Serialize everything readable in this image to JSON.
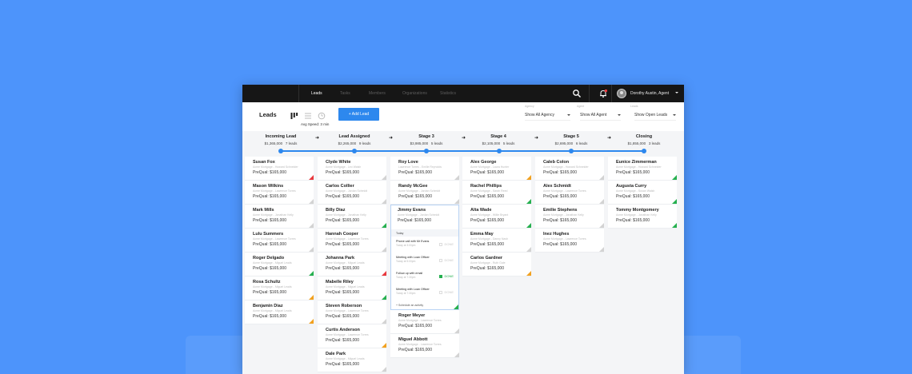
{
  "topbar": {
    "tabs": [
      {
        "label": "Leads",
        "active": true
      },
      {
        "label": "Tasks",
        "active": false
      },
      {
        "label": "Members",
        "active": false
      },
      {
        "label": "Organizations",
        "active": false
      },
      {
        "label": "Statistics",
        "active": false
      }
    ],
    "user_name": "Dorothy Austin, Agent",
    "icons": [
      "search-icon",
      "bell-icon",
      "avatar"
    ]
  },
  "toolbar": {
    "title": "Leads",
    "tooltip": "Avg Speed: 3 min",
    "add_button": "+ Add Lead",
    "filters": [
      {
        "label": "Agency",
        "value": "Show All Agency"
      },
      {
        "label": "Agent",
        "value": "Show All Agent"
      },
      {
        "label": "Leads",
        "value": "Show Open Leads"
      }
    ]
  },
  "colors": {
    "accent": "#2d88ee",
    "background": "#4d94fb",
    "topbar": "#161616",
    "red": "#e9383d",
    "green": "#25b04f",
    "orange": "#f2a11f"
  },
  "stages": [
    {
      "name": "Incoming Lead",
      "amount": "$1,365,000",
      "count": "7 leads"
    },
    {
      "name": "Lead Assigned",
      "amount": "$2,265,000",
      "count": "9 leads"
    },
    {
      "name": "Stage 3",
      "amount": "$3,985,000",
      "count": "5 leads"
    },
    {
      "name": "Stage 4",
      "amount": "$2,105,000",
      "count": "5 leads"
    },
    {
      "name": "Stage 5",
      "amount": "$2,695,000",
      "count": "6 leads"
    },
    {
      "name": "Closing",
      "amount": "$1,855,000",
      "count": "3 leads"
    }
  ],
  "columns": [
    {
      "cards": [
        {
          "name": "Susan Fox",
          "company": "Acme Mortgage - Howard Schneider",
          "prequal": "PreQual: $165,000",
          "flag": "red"
        },
        {
          "name": "Mason Wilkins",
          "company": "Acme Mortgage - Lawrence Torres",
          "prequal": "PreQual: $165,000",
          "flag": "gray"
        },
        {
          "name": "Mark Mills",
          "company": "Acme Mortgage - Jonathan Kelly",
          "prequal": "PreQual: $165,000",
          "flag": "gray"
        },
        {
          "name": "Lulu Summers",
          "company": "Acme Mortgage - Lawrence Torres",
          "prequal": "PreQual: $165,000",
          "flag": "gray"
        },
        {
          "name": "Roger Delgado",
          "company": "Acme Mortgage - Miguel Leads",
          "prequal": "PreQual: $165,000",
          "flag": "green"
        },
        {
          "name": "Rosa Schultz",
          "company": "Acme Mortgage - Miguel Leads",
          "prequal": "PreQual: $165,000",
          "flag": "orange"
        },
        {
          "name": "Benjamin Diaz",
          "company": "Acme Mortgage - Miguel Leads",
          "prequal": "PreQual: $165,000",
          "flag": "orange"
        }
      ]
    },
    {
      "cards": [
        {
          "name": "Clyde White",
          "company": "Acme Mortgage - Leo Walsh",
          "prequal": "PreQual: $165,000",
          "flag": "gray"
        },
        {
          "name": "Carlos Collier",
          "company": "Acme Mortgage - Jordan Schmidt",
          "prequal": "PreQual: $165,000",
          "flag": "gray"
        },
        {
          "name": "Billy Diaz",
          "company": "Acme Mortgage - Jonathan Kelly",
          "prequal": "PreQual: $165,000",
          "flag": "green"
        },
        {
          "name": "Hannah Cooper",
          "company": "Acme Mortgage - Lawrence Torres",
          "prequal": "PreQual: $165,000",
          "flag": "gray"
        },
        {
          "name": "Johanna Park",
          "company": "Acme Mortgage - Miguel Leads",
          "prequal": "PreQual: $165,000",
          "flag": "red"
        },
        {
          "name": "Mabelle Riley",
          "company": "Acme Mortgage - Miguel Leads",
          "prequal": "PreQual: $165,000",
          "flag": "green"
        },
        {
          "name": "Steven Roberson",
          "company": "Acme Mortgage - Lawrence Torres",
          "prequal": "PreQual: $165,000",
          "flag": "gray"
        },
        {
          "name": "Curtis Anderson",
          "company": "Acme Mortgage - Lawrence Torres",
          "prequal": "PreQual: $165,000",
          "flag": "orange"
        },
        {
          "name": "Dale Park",
          "company": "Acme Mortgage - Miguel Leads",
          "prequal": "PreQual: $165,000",
          "flag": "gray"
        }
      ]
    },
    {
      "cards_top": [
        {
          "name": "Roy Love",
          "company": "Lawrence Torres - Emilie Reynolds",
          "prequal": "PreQual: $165,000",
          "flag": "gray"
        },
        {
          "name": "Randy McGee",
          "company": "Acme Mortgage - Jordan Schmidt",
          "prequal": "PreQual: $165,000",
          "flag": "gray"
        }
      ],
      "expanded": {
        "name": "Jimmy Evans",
        "company": "Acme Mortgage - Jordan Schmidt",
        "prequal": "PreQual: $165,000",
        "section": "Today",
        "activities": [
          {
            "title": "Phone call with Mr Evans",
            "time": "Today at 3:00pm",
            "done": "DONE",
            "checked": false
          },
          {
            "title": "Meeting with Loan Officer",
            "time": "Today at 5:00pm",
            "done": "DONE",
            "checked": false
          },
          {
            "title": "Follow up with email",
            "time": "Today at 7:30pm",
            "done": "DONE",
            "checked": true
          },
          {
            "title": "Meeting with Loan Officer",
            "time": "Today at 7:30pm",
            "done": "DONE",
            "checked": false
          }
        ],
        "schedule": "+ Schedule an activity",
        "flag": "green"
      },
      "cards_bottom": [
        {
          "name": "Roger Meyer",
          "company": "Acme Mortgage - Lawrence Torres",
          "prequal": "PreQual: $165,000",
          "flag": "gray"
        },
        {
          "name": "Miguel Abbott",
          "company": "Acme Mortgage - Lawrence Torres",
          "prequal": "PreQual: $165,000",
          "flag": "gray"
        }
      ]
    },
    {
      "cards": [
        {
          "name": "Alex George",
          "company": "Acme Mortgage - Laura Hunter",
          "prequal": "PreQual: $165,000",
          "flag": "orange"
        },
        {
          "name": "Rachel Phillips",
          "company": "Acme Mortgage - Sarah Reed",
          "prequal": "PreQual: $165,000",
          "flag": "green"
        },
        {
          "name": "Alta Wade",
          "company": "Acme Mortgage - Willie Bryant",
          "prequal": "PreQual: $165,000",
          "flag": "green"
        },
        {
          "name": "Emma May",
          "company": "Acme Mortgage - Danny Nash",
          "prequal": "PreQual: $165,000",
          "flag": "gray"
        },
        {
          "name": "Carlos Gardner",
          "company": "Acme Mortgage - Ruth Gale",
          "prequal": "PreQual: $165,000",
          "flag": "orange"
        }
      ]
    },
    {
      "cards": [
        {
          "name": "Caleb Colon",
          "company": "Acme Mortgage - Howard Schneider",
          "prequal": "PreQual: $165,000",
          "flag": "gray"
        },
        {
          "name": "Alex Schmidt",
          "company": "Acme Mortgage - Lawrence Torres",
          "prequal": "PreQual: $165,000",
          "flag": "gray"
        },
        {
          "name": "Emilie Stephens",
          "company": "Acme Mortgage - Jonathan Kelly",
          "prequal": "PreQual: $165,000",
          "flag": "gray"
        },
        {
          "name": "Inez Hughes",
          "company": "Acme Mortgage - Lawrence Torres",
          "prequal": "PreQual: $165,000",
          "flag": "gray"
        }
      ]
    },
    {
      "cards": [
        {
          "name": "Eunice Zimmerman",
          "company": "Acme Mortgage - Howard Schneider",
          "prequal": "PreQual: $165,000",
          "flag": "green"
        },
        {
          "name": "Augusta Curry",
          "company": "Acme Mortgage - Susan Walsh",
          "prequal": "PreQual: $165,000",
          "flag": "green"
        },
        {
          "name": "Tommy Montgomery",
          "company": "Acme Mortgage - Jonathan Kelly",
          "prequal": "PreQual: $165,000",
          "flag": "green"
        }
      ]
    }
  ]
}
